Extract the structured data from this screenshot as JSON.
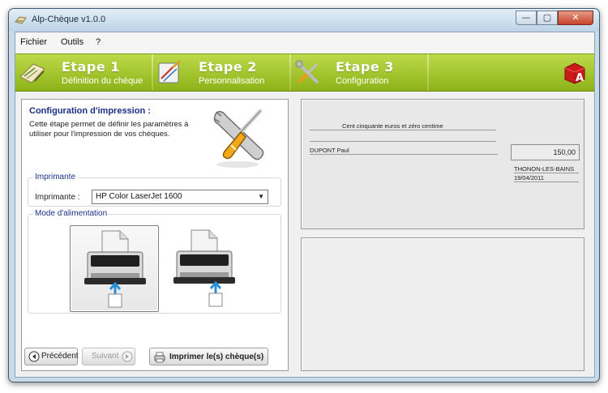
{
  "window": {
    "title": "Alp-Chèque v1.0.0",
    "controls": {
      "minimize": "—",
      "maximize": "▢",
      "close": "✕"
    }
  },
  "menu": {
    "items": [
      {
        "label": "Fichier"
      },
      {
        "label": "Outils"
      },
      {
        "label": "?"
      }
    ]
  },
  "steps": [
    {
      "title": "Etape 1",
      "subtitle": "Définition du chèque",
      "icon": "cheque-icon"
    },
    {
      "title": "Etape 2",
      "subtitle": "Personnalisation",
      "icon": "palette-icon"
    },
    {
      "title": "Etape 3",
      "subtitle": "Configuration",
      "icon": "tools-icon"
    }
  ],
  "brand_logo": {
    "icon": "alp-logo-icon",
    "letter": "A",
    "color": "#cc1a1a"
  },
  "config": {
    "title": "Configuration d'impression :",
    "description": "Cette étape permet de définir les paramètres à utiliser pour l'impression de vos chèques."
  },
  "printer_group": {
    "legend": "Imprimante",
    "label": "Imprimante :",
    "selected": "HP Color LaserJet 1600"
  },
  "feed_group": {
    "legend": "Mode d'alimentation",
    "options": [
      {
        "name": "feed-option-center",
        "selected": true
      },
      {
        "name": "feed-option-right",
        "selected": false
      }
    ]
  },
  "buttons": {
    "previous": "Précédent",
    "next": "Suivant",
    "print": "Imprimer le(s) chèque(s)"
  },
  "cheque": {
    "amount_words": "Cent cinquante euros et zéro centime",
    "payee": "DUPONT Paul",
    "amount": "150,00",
    "place": "THONON-LES-BAINS",
    "date": "19/04/2011"
  },
  "colors": {
    "step_bar": "#a3c52c",
    "title_accent": "#1a2f84",
    "close_button": "#c7432a"
  }
}
